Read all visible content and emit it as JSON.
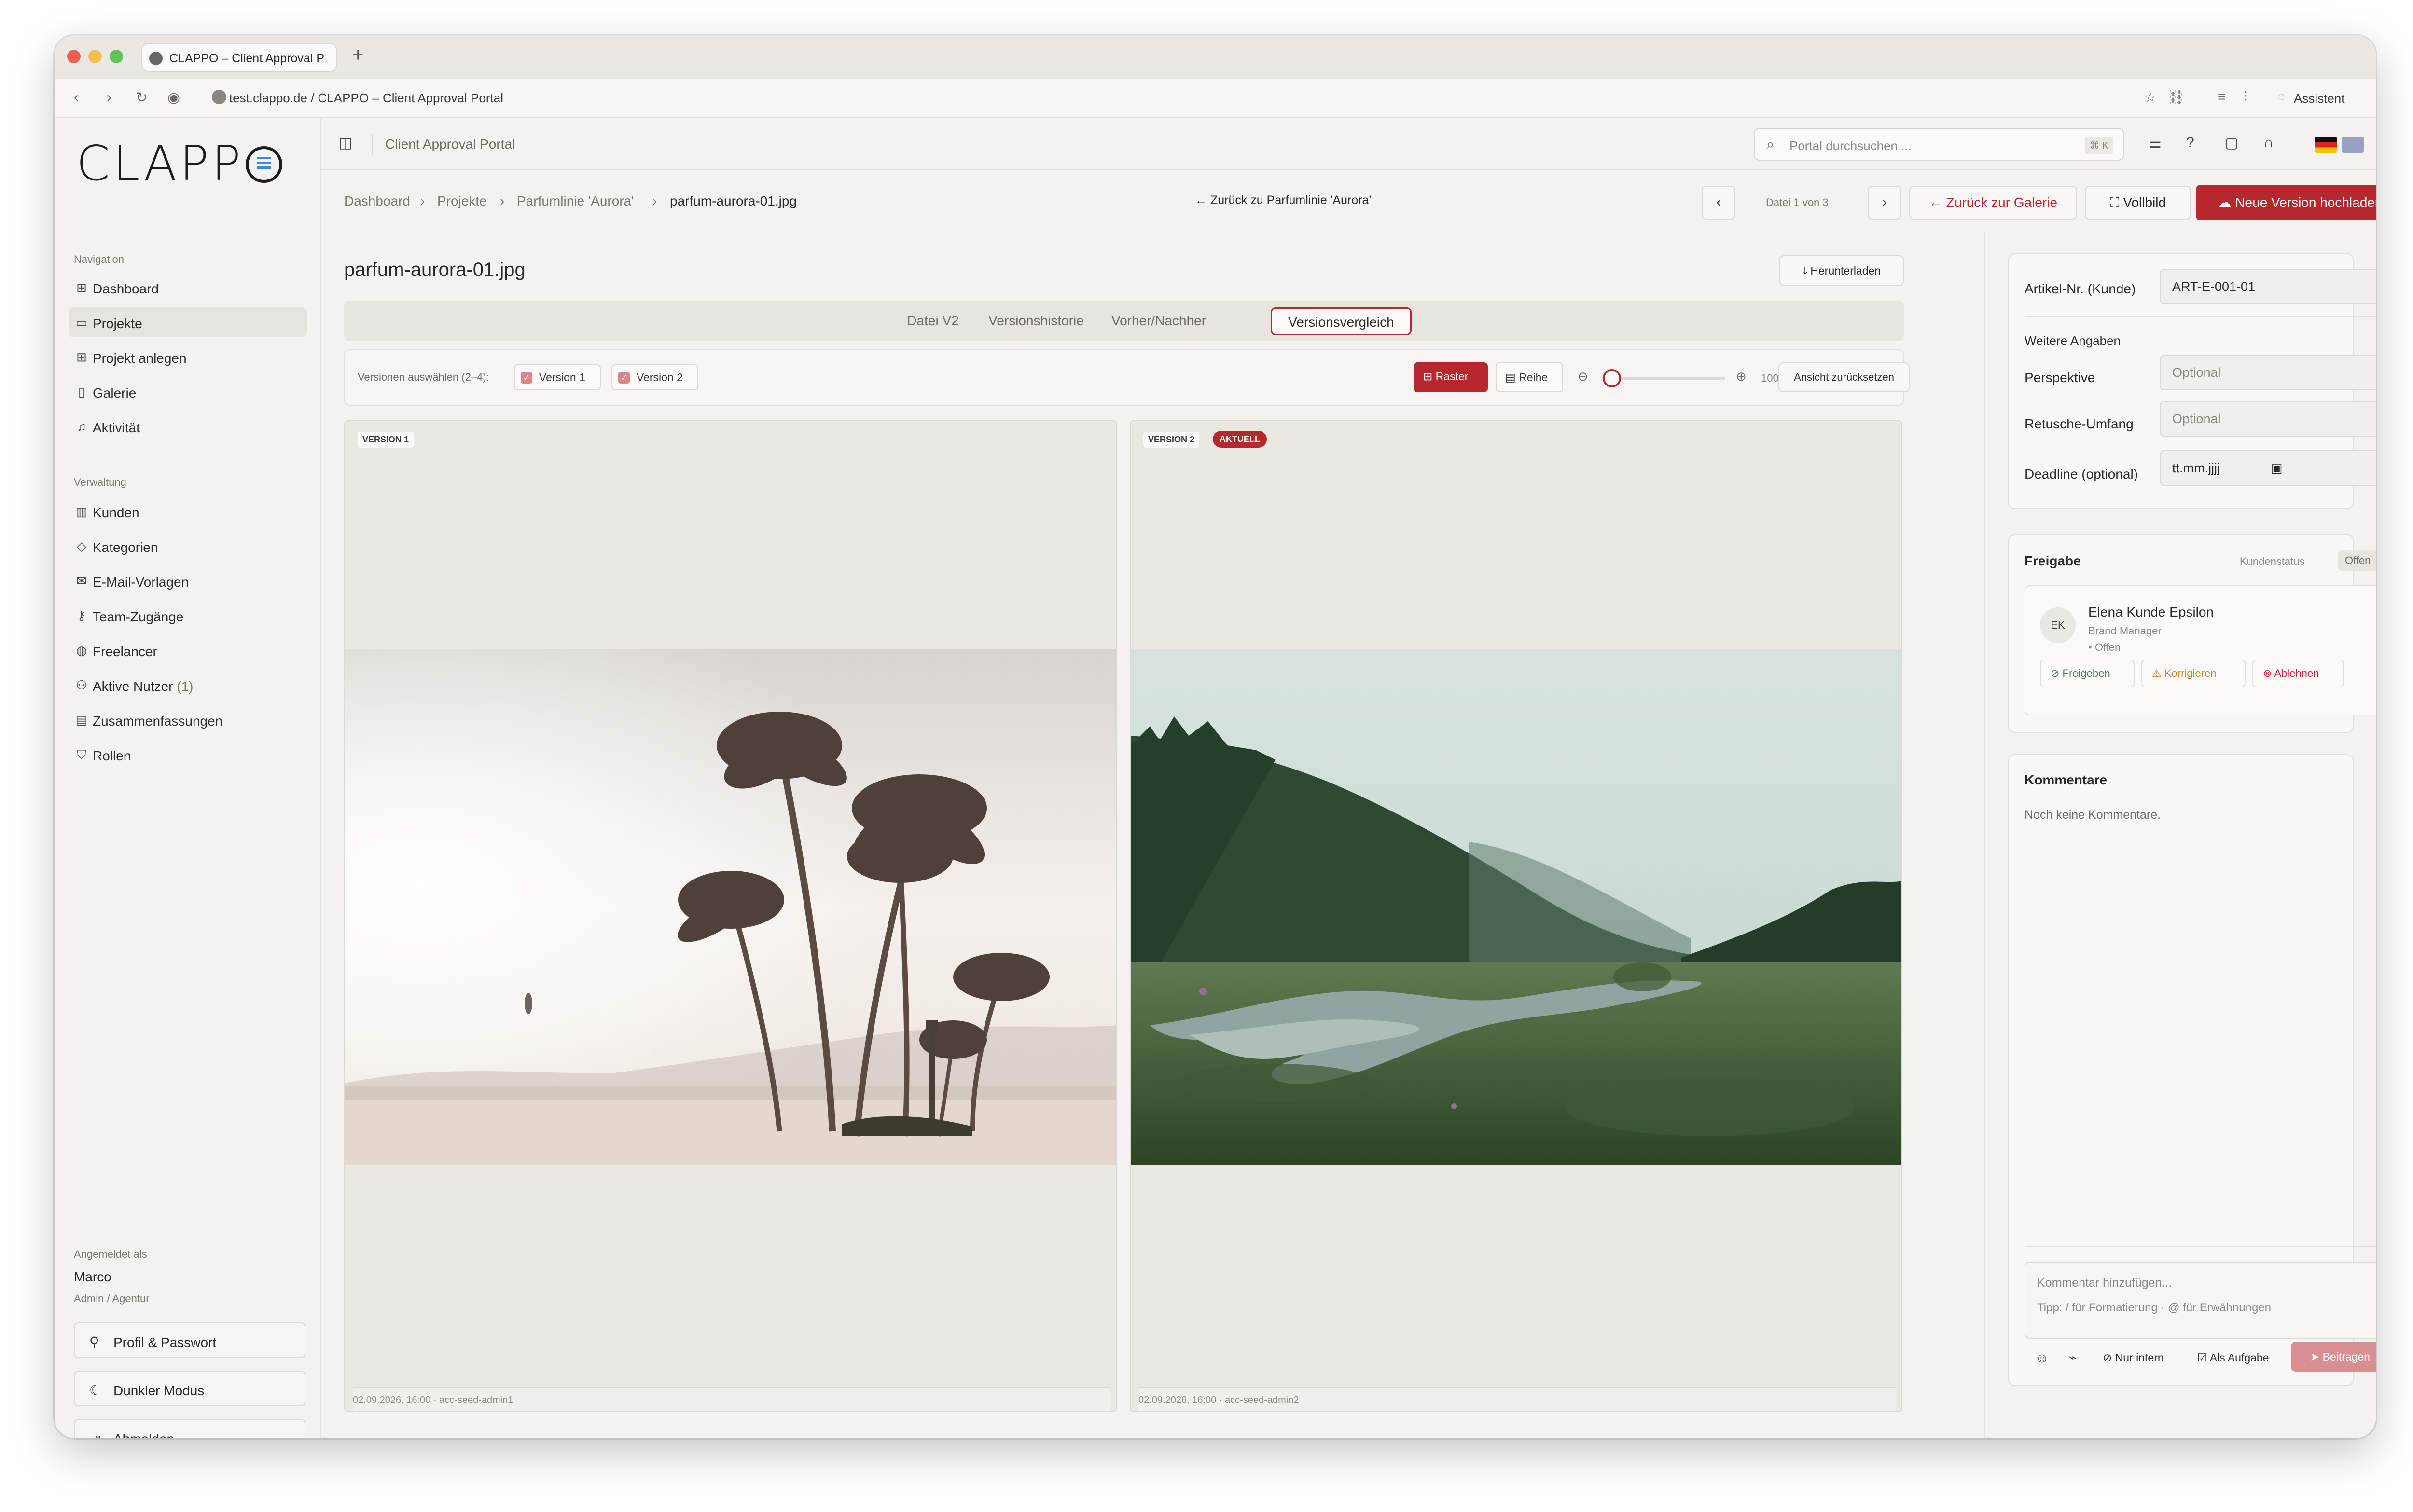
{
  "browser": {
    "tab_title": "CLAPPO – Client Approval P",
    "new_tab": "+",
    "url": "test.clappo.de / CLAPPO – Client Approval Portal",
    "assistant": "Assistent"
  },
  "sidebar": {
    "logo": "CLAPP",
    "nav_title": "Navigation",
    "nav_items": [
      {
        "label": "Dashboard",
        "icon": "grid-icon"
      },
      {
        "label": "Projekte",
        "icon": "folder-icon"
      },
      {
        "label": "Projekt anlegen",
        "icon": "folder-plus-icon"
      },
      {
        "label": "Galerie",
        "icon": "gallery-icon"
      },
      {
        "label": "Aktivität",
        "icon": "bell-icon"
      }
    ],
    "admin_title": "Verwaltung",
    "admin_items": [
      {
        "label": "Kunden",
        "icon": "building-icon"
      },
      {
        "label": "Kategorien",
        "icon": "tag-icon"
      },
      {
        "label": "E-Mail-Vorlagen",
        "icon": "mail-icon"
      },
      {
        "label": "Team-Zugänge",
        "icon": "key-icon"
      },
      {
        "label": "Freelancer",
        "icon": "palette-icon"
      },
      {
        "label": "Aktive Nutzer",
        "count": "(1)",
        "icon": "users-icon"
      },
      {
        "label": "Zusammenfassungen",
        "icon": "summary-icon"
      },
      {
        "label": "Rollen",
        "icon": "shield-icon"
      }
    ],
    "signed_in_label": "Angemeldet als",
    "user_name": "Marco",
    "user_role": "Admin / Agentur",
    "profile_button": "Profil & Passwort",
    "dark_mode_button": "Dunkler Modus",
    "logout_button": "Abmelden"
  },
  "header": {
    "portal_title": "Client Approval Portal",
    "search_placeholder": "Portal durchsuchen ...",
    "search_shortcut": "⌘ K"
  },
  "breadcrumb": [
    "Dashboard",
    "Projekte",
    "Parfumlinie 'Aurora'",
    "parfum-aurora-01.jpg"
  ],
  "toolbar": {
    "back_link": "Zurück zu Parfumlinie 'Aurora'",
    "file_counter": "Datei 1 von 3",
    "back_gallery": "Zurück zur Galerie",
    "fullscreen": "Vollbild",
    "upload_version": "Neue Version hochladen"
  },
  "main": {
    "file_title": "parfum-aurora-01.jpg",
    "download": "Herunterladen",
    "tabs": [
      "Datei V2",
      "Versionshistorie",
      "Vorher/Nachher",
      "Versionsvergleich"
    ],
    "active_tab": "Versionsvergleich",
    "select_versions_label": "Versionen auswählen (2–4):",
    "version_chips": [
      "Version 1",
      "Version 2"
    ],
    "view_grid": "Raster",
    "view_row": "Reihe",
    "zoom": "100%",
    "reset_view": "Ansicht zurücksetzen"
  },
  "panels": [
    {
      "label": "VERSION 1",
      "meta": "02.09.2026, 16:00 · acc-seed-admin1"
    },
    {
      "label": "VERSION 2",
      "badge": "AKTUELL",
      "meta": "02.09.2026, 16:00 · acc-seed-admin2"
    }
  ],
  "details": {
    "article_label": "Artikel-Nr. (Kunde)",
    "article_value": "ART-E-001-01",
    "more_info": "Weitere Angaben",
    "perspective_label": "Perspektive",
    "perspective_placeholder": "Optional",
    "retouch_label": "Retusche-Umfang",
    "retouch_placeholder": "Optional",
    "deadline_label": "Deadline (optional)",
    "deadline_placeholder": "tt.mm.jjjj"
  },
  "approval": {
    "title": "Freigabe",
    "status_label": "Kundenstatus",
    "status_value": "Offen",
    "initials": "EK",
    "reviewer_name": "Elena Kunde Epsilon",
    "reviewer_role": "Brand Manager",
    "reviewer_status": "Offen",
    "approve": "Freigeben",
    "correct": "Korrigieren",
    "reject": "Ablehnen"
  },
  "comments": {
    "title": "Kommentare",
    "empty": "Noch keine Kommentare.",
    "placeholder": "Kommentar hinzufügen...",
    "tip": "Tipp: / für Formatierung · @ für Erwähnungen",
    "internal": "Nur intern",
    "as_task": "Als Aufgabe",
    "submit": "Beitragen"
  },
  "colors": {
    "accent": "#b4282e",
    "warning": "#c9842a",
    "success": "#4f7a4a"
  }
}
